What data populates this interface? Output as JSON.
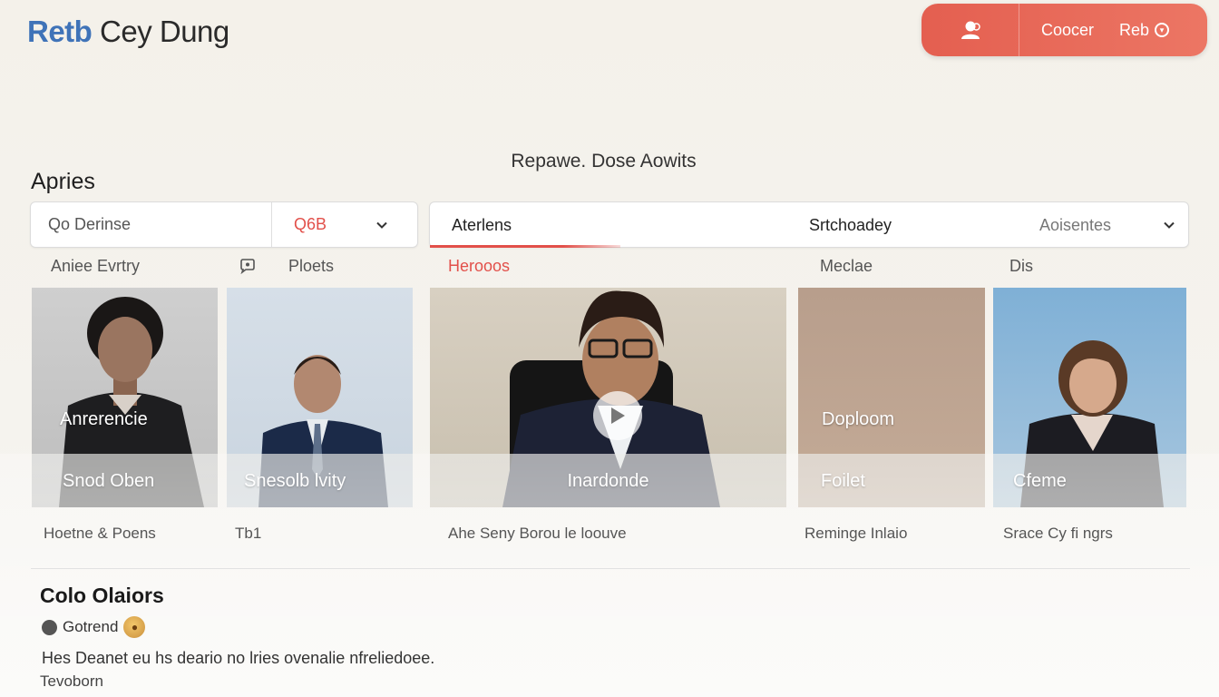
{
  "header": {
    "brand_part1": "Retb",
    "brand_part2": " Cey Dung",
    "pill_link_1": "Coocer",
    "pill_link_2": "Reb",
    "accent_color": "#e45f50"
  },
  "page": {
    "center_heading": "Repawe. Dose Aowits",
    "section_label": "Apries"
  },
  "filters": {
    "search_value": "Qo Derinse",
    "select_value": "Q6B",
    "tabs": [
      "Aterlens",
      "Srtchoadey",
      "Aoisentes"
    ],
    "active_tab_index": 0
  },
  "sub_labels": {
    "col1": "Aniee Evrtry",
    "col2": "Ploets",
    "col3": "Herooos",
    "col4": "Meclae",
    "col5": "Dis"
  },
  "cards": [
    {
      "title_mid": "Anrerencie",
      "title_low": "Snod Oben",
      "caption": "Hoetne & Poens",
      "photo_icon": "person-portrait"
    },
    {
      "title_mid": "",
      "title_low": "Snesolb lvity",
      "caption": "Tb1",
      "photo_icon": "person-portrait"
    },
    {
      "title_mid": "",
      "title_low": "Inardonde",
      "caption": "Ahe Seny Borou le loouve",
      "photo_icon": "person-portrait-video"
    },
    {
      "title_mid": "Doploom",
      "title_low": "Foilet",
      "caption": "Reminge Inlaio",
      "photo_icon": "blank-photo"
    },
    {
      "title_mid": "",
      "title_low": "Cfeme",
      "caption": "Srace Cy fi ngrs",
      "photo_icon": "person-portrait"
    }
  ],
  "bottom": {
    "title": "Colo Olaiors",
    "meta_label": "Gotrend",
    "description": "Hes Deanet eu hs deario no lries ovenalie nfreliedoee.",
    "tag": "Tevoborn"
  }
}
